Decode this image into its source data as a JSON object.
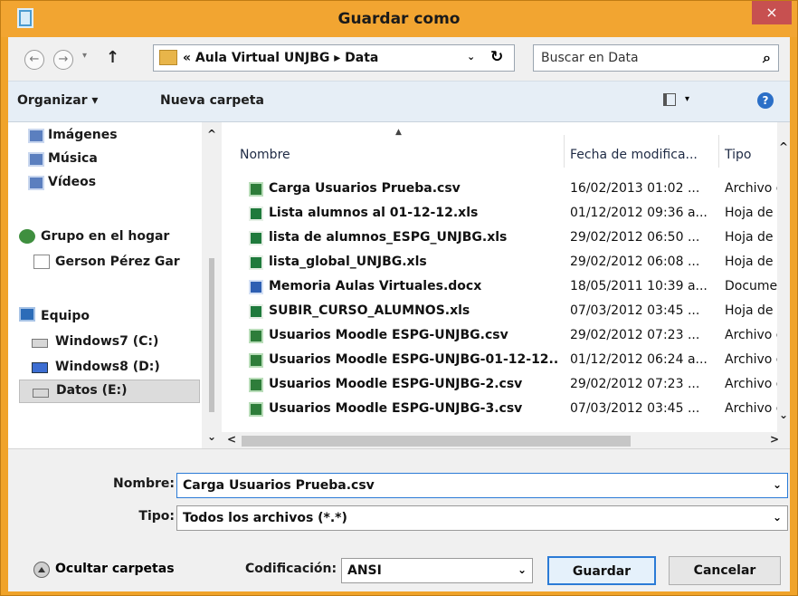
{
  "window": {
    "title": "Guardar como",
    "close_glyph": "×"
  },
  "address": {
    "back_glyph": "←",
    "forward_glyph": "→",
    "history_glyph": "▾",
    "up_glyph": "↑",
    "path_text": "« Aula Virtual UNJBG ▸ Data",
    "dropdown_glyph": "⌄",
    "refresh_glyph": "↻"
  },
  "search": {
    "placeholder": "Buscar en Data",
    "icon_glyph": "⌕"
  },
  "toolbar": {
    "organize_label": "Organizar ▾",
    "new_folder_label": "Nueva carpeta",
    "view_dd_glyph": "▾",
    "help_glyph": "?"
  },
  "nav": {
    "items": [
      {
        "label": "Imágenes"
      },
      {
        "label": "Música"
      },
      {
        "label": "Vídeos"
      },
      {
        "label": "Grupo en el hogar"
      },
      {
        "label": "Gerson Pérez Gar"
      },
      {
        "label": "Equipo"
      },
      {
        "label": "Windows7 (C:)"
      },
      {
        "label": "Windows8 (D:)"
      },
      {
        "label": "Datos (E:)"
      }
    ],
    "scroll_up": "^",
    "scroll_down": "⌄"
  },
  "files": {
    "columns": {
      "name": "Nombre",
      "date": "Fecha de modifica...",
      "type": "Tipo"
    },
    "rows": [
      {
        "name": "Carga Usuarios Prueba.csv",
        "date": "16/02/2013 01:02 ...",
        "type": "Archivo c",
        "icon": "csv-file-icon"
      },
      {
        "name": "Lista alumnos al 01-12-12.xls",
        "date": "01/12/2012 09:36 a...",
        "type": "Hoja de c",
        "icon": "xls-file-icon"
      },
      {
        "name": "lista de alumnos_ESPG_UNJBG.xls",
        "date": "29/02/2012 06:50 ...",
        "type": "Hoja de c",
        "icon": "xls-file-icon"
      },
      {
        "name": "lista_global_UNJBG.xls",
        "date": "29/02/2012 06:08 ...",
        "type": "Hoja de c",
        "icon": "xls-file-icon"
      },
      {
        "name": "Memoria Aulas Virtuales.docx",
        "date": "18/05/2011 10:39 a...",
        "type": "Documer",
        "icon": "docx-file-icon"
      },
      {
        "name": "SUBIR_CURSO_ALUMNOS.xls",
        "date": "07/03/2012 03:45 ...",
        "type": "Hoja de c",
        "icon": "xls-file-icon"
      },
      {
        "name": "Usuarios Moodle ESPG-UNJBG.csv",
        "date": "29/02/2012 07:23 ...",
        "type": "Archivo c",
        "icon": "csv-file-icon"
      },
      {
        "name": "Usuarios Moodle ESPG-UNJBG-01-12-12....",
        "date": "01/12/2012 06:24 a...",
        "type": "Archivo c",
        "icon": "csv-file-icon"
      },
      {
        "name": "Usuarios Moodle ESPG-UNJBG-2.csv",
        "date": "29/02/2012 07:23 ...",
        "type": "Archivo c",
        "icon": "csv-file-icon"
      },
      {
        "name": "Usuarios Moodle ESPG-UNJBG-3.csv",
        "date": "07/03/2012 03:45 ...",
        "type": "Archivo c",
        "icon": "csv-file-icon"
      }
    ],
    "scroll_up": "^",
    "scroll_down": "⌄",
    "scroll_left": "<",
    "scroll_right": ">"
  },
  "form": {
    "name_label": "Nombre:",
    "name_value": "Carga Usuarios Prueba.csv",
    "type_label": "Tipo:",
    "type_value": "Todos los archivos  (*.*)",
    "dd_glyph": "⌄",
    "encoding_label": "Codificación:",
    "encoding_value": "ANSI"
  },
  "buttons": {
    "save": "Guardar",
    "cancel": "Cancelar",
    "hide_folders": "Ocultar carpetas"
  }
}
